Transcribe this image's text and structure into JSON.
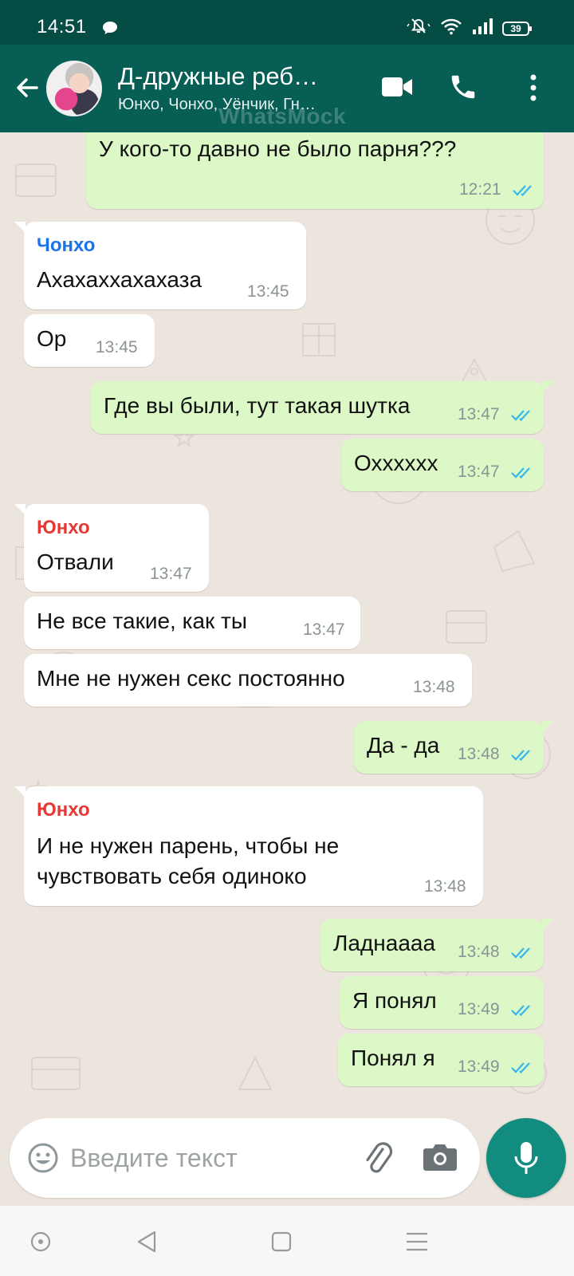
{
  "status_bar": {
    "time": "14:51",
    "battery": "39",
    "icons": [
      "message-icon",
      "mute-icon",
      "wifi-icon",
      "signal-icon",
      "battery-icon"
    ]
  },
  "header": {
    "title": "Д-дружные реб…",
    "subtitle": "Юнхо, Чонхо, Уёнчик, Гн…",
    "watermark": "WhatsMock",
    "icons": [
      "back-arrow-icon",
      "video-call-icon",
      "phone-icon",
      "more-vert-icon"
    ]
  },
  "colors": {
    "header": "#075e54",
    "status_bar": "#054d44",
    "outgoing_bubble": "#dcf8c6",
    "incoming_bubble": "#ffffff",
    "sender_chonho": "#1a73e8",
    "sender_yunho": "#e53935",
    "read_ticks": "#34b7f1",
    "mic_button": "#128c7e"
  },
  "messages": [
    {
      "dir": "out",
      "text": "У кого-то давно не было парня???",
      "time": "12:21",
      "read": true
    },
    {
      "dir": "in",
      "sender": "Чонхо",
      "text": "Ахахаххахахаза",
      "time": "13:45"
    },
    {
      "dir": "in",
      "text": "Ор",
      "time": "13:45"
    },
    {
      "dir": "out",
      "text": "Где вы были, тут такая шутка",
      "time": "13:47",
      "read": true
    },
    {
      "dir": "out",
      "text": "Охххххх",
      "time": "13:47",
      "read": true
    },
    {
      "dir": "in",
      "sender": "Юнхо",
      "text": "Отвали",
      "time": "13:47"
    },
    {
      "dir": "in",
      "text": "Не все такие, как ты",
      "time": "13:47"
    },
    {
      "dir": "in",
      "text": "Мне не нужен секс постоянно",
      "time": "13:48"
    },
    {
      "dir": "out",
      "text": "Да - да",
      "time": "13:48",
      "read": true
    },
    {
      "dir": "in",
      "sender": "Юнхо",
      "text_line1": "И не нужен парень, чтобы не",
      "text_line2": "чувствовать себя одиноко",
      "time": "13:48"
    },
    {
      "dir": "out",
      "text": "Ладнаааа",
      "time": "13:48",
      "read": true
    },
    {
      "dir": "out",
      "text": "Я понял",
      "time": "13:49",
      "read": true
    },
    {
      "dir": "out",
      "text": "Понял я",
      "time": "13:49",
      "read": true
    }
  ],
  "composer": {
    "placeholder": "Введите текст",
    "icons": [
      "emoji-icon",
      "attach-icon",
      "camera-icon",
      "mic-icon"
    ]
  },
  "navbar": {
    "icons": [
      "home-icon",
      "back-icon",
      "recents-icon",
      "menu-icon"
    ]
  }
}
